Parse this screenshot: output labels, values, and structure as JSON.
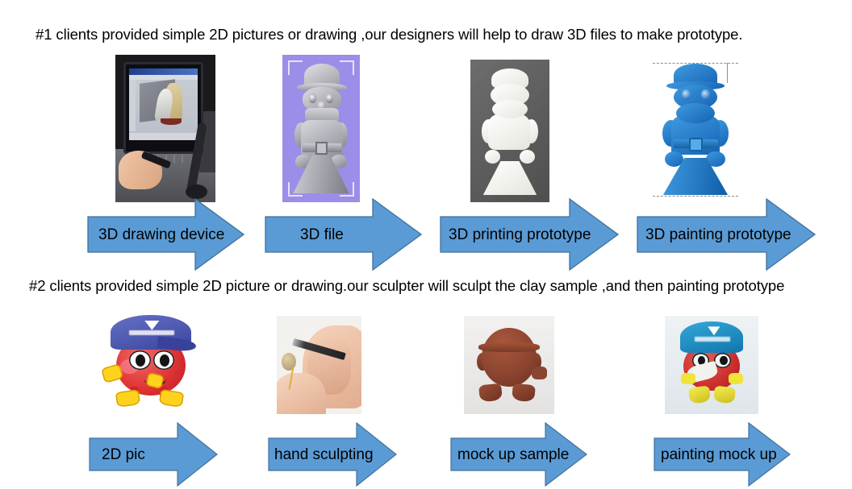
{
  "document": {
    "title": "Prototype Process Flow",
    "background_color": "#ffffff",
    "arrow_color": "#5B9BD5",
    "arrow_outline_color": "#41719C",
    "text_color": "#000000"
  },
  "rows": [
    {
      "id": "row-1",
      "heading": "#1 clients provided simple 2D pictures or drawing ,our designers will help to draw 3D files to make prototype.",
      "steps": [
        {
          "label": "3D drawing device",
          "image_name": "cad-workstation-photo"
        },
        {
          "label": "3D file",
          "image_name": "cad-3d-model-render"
        },
        {
          "label": "3D printing prototype",
          "image_name": "white-3d-printed-figure-photo"
        },
        {
          "label": "3D painting prototype",
          "image_name": "blue-painted-figure-render"
        }
      ]
    },
    {
      "id": "row-2",
      "heading": "#2 clients provided simple 2D picture or drawing.our sculpter will sculpt the clay sample ,and then painting prototype",
      "steps": [
        {
          "label": "2D pic",
          "image_name": "red-mascot-cartoon"
        },
        {
          "label": "hand sculpting",
          "image_name": "hand-sculpting-clay-photo"
        },
        {
          "label": "mock up sample",
          "image_name": "brown-clay-mockup-photo"
        },
        {
          "label": "painting mock up",
          "image_name": "painted-mockup-photo"
        }
      ]
    }
  ]
}
